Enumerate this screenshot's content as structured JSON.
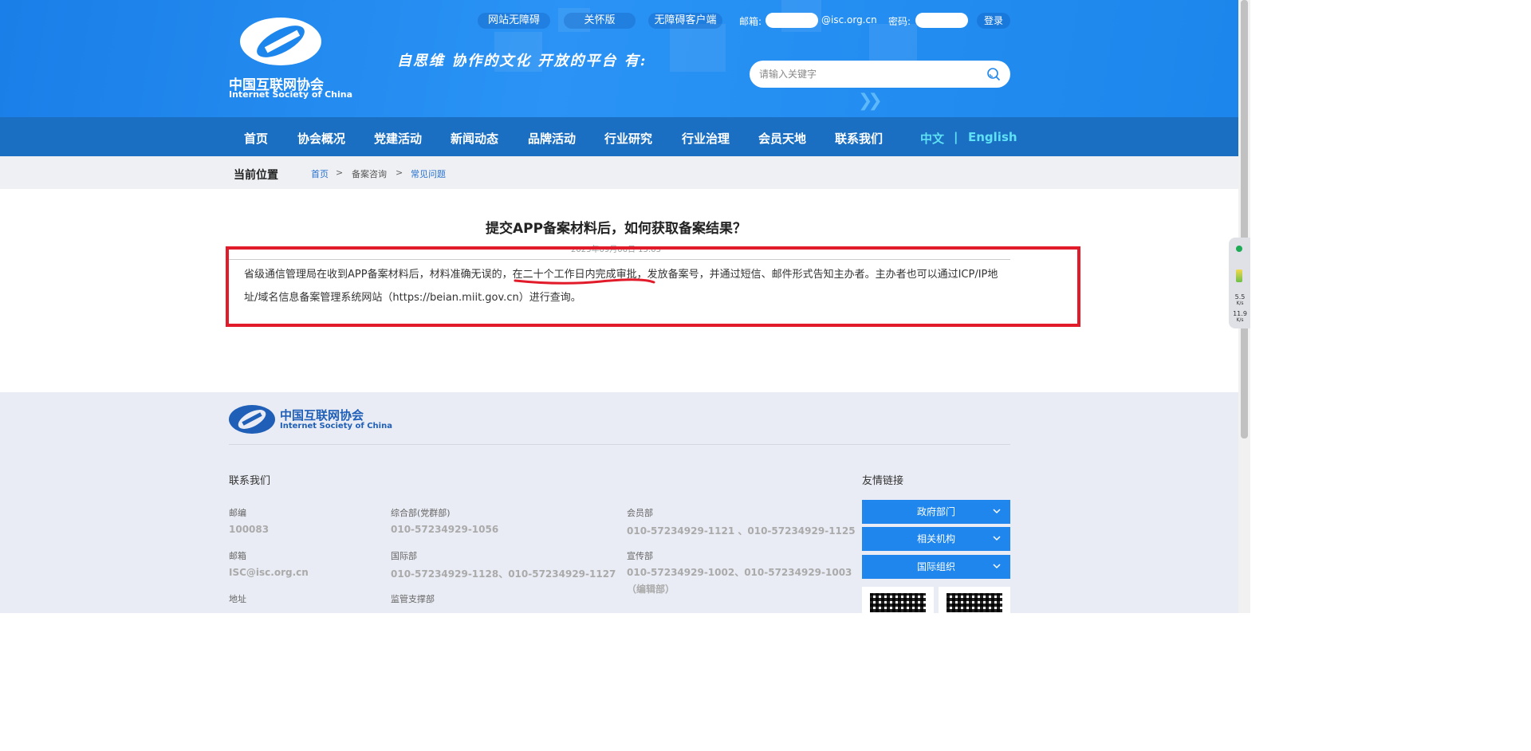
{
  "header": {
    "logo_cn": "中国互联网协会",
    "logo_en": "Internet Society of China",
    "slogan": "自思维  协作的文化  开放的平台  有:",
    "top_links": [
      "网站无障碍",
      "关怀版",
      "无障碍客户端"
    ],
    "login": {
      "email_label": "邮箱:",
      "email_domain": "@isc.org.cn",
      "password_label": "密码:",
      "login_button": "登录"
    },
    "search_placeholder": "请输入关键字"
  },
  "nav": {
    "items": [
      "首页",
      "协会概况",
      "党建活动",
      "新闻动态",
      "品牌活动",
      "行业研究",
      "行业治理",
      "会员天地",
      "联系我们"
    ],
    "lang_cn": "中文",
    "lang_sep": "|",
    "lang_en": "English"
  },
  "breadcrumb": {
    "title": "当前位置",
    "home": "首页",
    "sep": ">",
    "section": "备案咨询",
    "current": "常见问题"
  },
  "article": {
    "title": "提交APP备案材料后，如何获取备案结果？",
    "date": "2023年09月06日 15:03",
    "body_before": "省级通信管理局在收到APP备案材料后，材料准确无误的，",
    "body_highlight": "在二十个工作日内完成审批",
    "body_after": "，发放备案号，并通过短信、邮件形式告知主办者。主办者也可以通过ICP/IP地址/域名信息备案管理系统网站（https://beian.miit.gov.cn）进行查询。"
  },
  "footer": {
    "logo_cn": "中国互联网协会",
    "logo_en": "Internet Society of China",
    "contact_title": "联系我们",
    "links_title": "友情链接",
    "postcode_label": "邮编",
    "postcode": "100083",
    "email_label": "邮箱",
    "email": "ISC@isc.org.cn",
    "address_label": "地址",
    "dept1_label": "综合部(党群部)",
    "dept1": "010-57234929-1056",
    "dept2_label": "国际部",
    "dept2": "010-57234929-1128、010-57234929-1127",
    "dept3_label": "监管支撑部",
    "dept4_label": "会员部",
    "dept4": "010-57234929-1121 、010-57234929-1125",
    "dept5_label": "宣传部",
    "dept5": "010-57234929-1002、010-57234929-1003（编辑部）",
    "link_buttons": [
      "政府部门",
      "相关机构",
      "国际组织"
    ]
  },
  "widget": {
    "up": "5.5",
    "up_unit": "K/s",
    "down": "11.9",
    "down_unit": "K/s"
  },
  "colors": {
    "header_blue": "#1d86ec",
    "nav_blue": "#1b6fc2",
    "lang_cyan": "#5ee1f4",
    "highlight_red": "#e21b2a"
  }
}
